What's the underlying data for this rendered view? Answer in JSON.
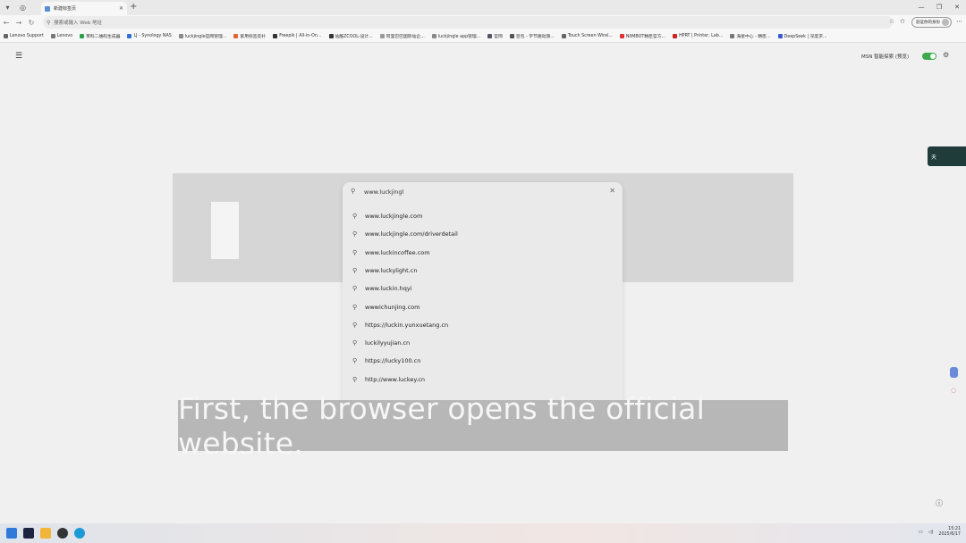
{
  "browser": {
    "tab_title": "新建标签页",
    "address_placeholder": "搜索或输入 Web 地址",
    "profile_label": "验证你的身份"
  },
  "bookmarks": [
    "Lenovo Support",
    "Lenovo",
    "草料二维码生成器",
    "LJ - Synology NAS",
    "luckjingle官网管理...",
    "家用标签反扑",
    "Freepik | All-in-On...",
    "站酷ZCOOL-设计...",
    "阿里巴巴国际站企...",
    "luckjingle app管理...",
    "官网",
    "豆包 - 字节跳动旗...",
    "Touch Screen Wirel...",
    "NIIMBOT精臣官方...",
    "HPRT | Printer, Lab...",
    "海星中心 - 精臣...",
    "DeepSeek | 深度求..."
  ],
  "page": {
    "msn_label": "MSN 智能探索 (预览)",
    "weather_label": "天"
  },
  "search": {
    "input_value": "www.luckjingl",
    "suggestions": [
      "www.luckjingle.com",
      "www.luckjingle.com/driverdetail",
      "www.luckincoffee.com",
      "www.luckylight.cn",
      "www.luckin.hqyi",
      "wwwichunjing.com",
      "https://luckin.yunxuetang.cn",
      "luckilyyujian.cn",
      "https://lucky100.cn",
      "http://www.luckey.cn"
    ]
  },
  "caption": "First, the browser opens the official website.",
  "taskbar": {
    "time": "15:21",
    "date": "2025/6/17"
  }
}
